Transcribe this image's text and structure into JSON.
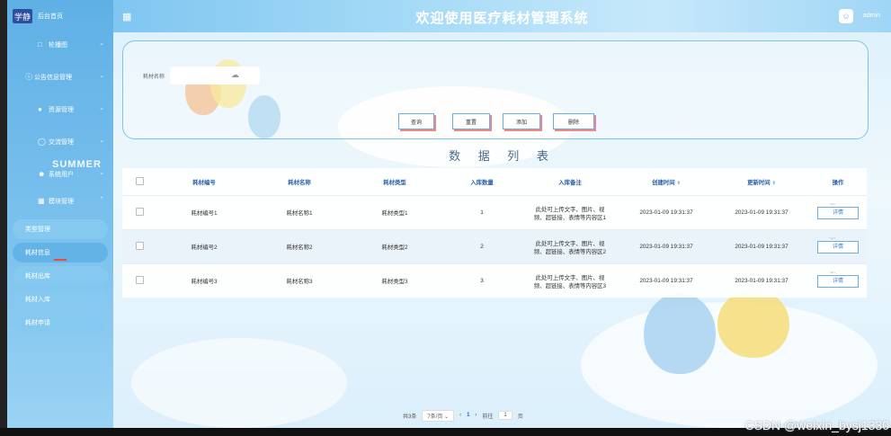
{
  "sidebar": {
    "logo_badge": "学静",
    "logo_text": "后台首页",
    "menu": [
      {
        "label": "轮播图",
        "icon": "image-icon"
      },
      {
        "label": "公告信息管理",
        "icon": "info-icon"
      },
      {
        "label": "资源管理",
        "icon": "dot-icon"
      },
      {
        "label": "交流管理",
        "icon": "chat-icon"
      },
      {
        "label": "系统用户",
        "icon": "user-icon"
      },
      {
        "label": "模块管理",
        "icon": "grid-icon"
      }
    ],
    "decor_text": "SUMMER",
    "sub_items": [
      {
        "label": "类型管理"
      },
      {
        "label": "耗材信息"
      },
      {
        "label": "耗材出库"
      },
      {
        "label": "耗材入库"
      },
      {
        "label": "耗材申请"
      }
    ]
  },
  "header": {
    "title": "欢迎使用医疗耗材管理系统",
    "user": "admin"
  },
  "search": {
    "label": "耗材名称",
    "placeholder": "",
    "buttons": {
      "query": "查询",
      "reset": "重置",
      "add": "添加",
      "delete": "删除"
    }
  },
  "table": {
    "title": "数 据 列 表",
    "headers": [
      "耗材编号",
      "耗材名称",
      "耗材类型",
      "入库数量",
      "入库备注",
      "创建时间",
      "更新时间",
      "操作"
    ],
    "rows": [
      {
        "code": "耗材编号1",
        "name": "耗材名称1",
        "type": "耗材类型1",
        "qty": "1",
        "note_line1": "此处可上传文字、图片、视",
        "note_line2": "频、超链接、表情等内容区1",
        "created": "2023-01-09 19:31:37",
        "updated": "2023-01-09 19:31:37",
        "action": "详情"
      },
      {
        "code": "耗材编号2",
        "name": "耗材名称2",
        "type": "耗材类型2",
        "qty": "2",
        "note_line1": "此处可上传文字、图片、视",
        "note_line2": "频、超链接、表情等内容区2",
        "created": "2023-01-09 19:31:37",
        "updated": "2023-01-09 19:31:37",
        "action": "详情"
      },
      {
        "code": "耗材编号3",
        "name": "耗材名称3",
        "type": "耗材类型3",
        "qty": "3",
        "note_line1": "此处可上传文字、图片、视",
        "note_line2": "频、超链接、表情等内容区3",
        "created": "2023-01-09 19:31:37",
        "updated": "2023-01-09 19:31:37",
        "action": "详情"
      }
    ]
  },
  "pagination": {
    "total": "共3条",
    "page_size": "7条/页",
    "current": "1",
    "goto_label": "前往",
    "goto_value": "1",
    "page_suffix": "页"
  },
  "watermark": "CSDN @weixin_bysj1330",
  "colors": {
    "accent": "#6ab7ea",
    "header_title": "#ffffff",
    "table_header": "#2f62a5"
  }
}
